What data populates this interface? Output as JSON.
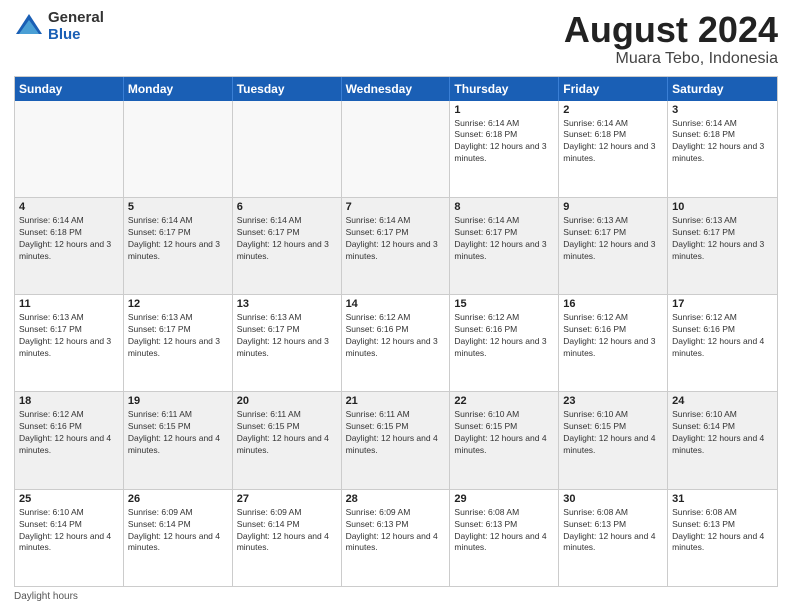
{
  "header": {
    "logo_general": "General",
    "logo_blue": "Blue",
    "title": "August 2024",
    "location": "Muara Tebo, Indonesia"
  },
  "calendar": {
    "days_of_week": [
      "Sunday",
      "Monday",
      "Tuesday",
      "Wednesday",
      "Thursday",
      "Friday",
      "Saturday"
    ],
    "weeks": [
      [
        {
          "day": "",
          "empty": true
        },
        {
          "day": "",
          "empty": true
        },
        {
          "day": "",
          "empty": true
        },
        {
          "day": "",
          "empty": true
        },
        {
          "day": "1",
          "sunrise": "6:14 AM",
          "sunset": "6:18 PM",
          "daylight": "12 hours and 3 minutes."
        },
        {
          "day": "2",
          "sunrise": "6:14 AM",
          "sunset": "6:18 PM",
          "daylight": "12 hours and 3 minutes."
        },
        {
          "day": "3",
          "sunrise": "6:14 AM",
          "sunset": "6:18 PM",
          "daylight": "12 hours and 3 minutes."
        }
      ],
      [
        {
          "day": "4",
          "sunrise": "6:14 AM",
          "sunset": "6:18 PM",
          "daylight": "12 hours and 3 minutes."
        },
        {
          "day": "5",
          "sunrise": "6:14 AM",
          "sunset": "6:17 PM",
          "daylight": "12 hours and 3 minutes."
        },
        {
          "day": "6",
          "sunrise": "6:14 AM",
          "sunset": "6:17 PM",
          "daylight": "12 hours and 3 minutes."
        },
        {
          "day": "7",
          "sunrise": "6:14 AM",
          "sunset": "6:17 PM",
          "daylight": "12 hours and 3 minutes."
        },
        {
          "day": "8",
          "sunrise": "6:14 AM",
          "sunset": "6:17 PM",
          "daylight": "12 hours and 3 minutes."
        },
        {
          "day": "9",
          "sunrise": "6:13 AM",
          "sunset": "6:17 PM",
          "daylight": "12 hours and 3 minutes."
        },
        {
          "day": "10",
          "sunrise": "6:13 AM",
          "sunset": "6:17 PM",
          "daylight": "12 hours and 3 minutes."
        }
      ],
      [
        {
          "day": "11",
          "sunrise": "6:13 AM",
          "sunset": "6:17 PM",
          "daylight": "12 hours and 3 minutes."
        },
        {
          "day": "12",
          "sunrise": "6:13 AM",
          "sunset": "6:17 PM",
          "daylight": "12 hours and 3 minutes."
        },
        {
          "day": "13",
          "sunrise": "6:13 AM",
          "sunset": "6:17 PM",
          "daylight": "12 hours and 3 minutes."
        },
        {
          "day": "14",
          "sunrise": "6:12 AM",
          "sunset": "6:16 PM",
          "daylight": "12 hours and 3 minutes."
        },
        {
          "day": "15",
          "sunrise": "6:12 AM",
          "sunset": "6:16 PM",
          "daylight": "12 hours and 3 minutes."
        },
        {
          "day": "16",
          "sunrise": "6:12 AM",
          "sunset": "6:16 PM",
          "daylight": "12 hours and 3 minutes."
        },
        {
          "day": "17",
          "sunrise": "6:12 AM",
          "sunset": "6:16 PM",
          "daylight": "12 hours and 4 minutes."
        }
      ],
      [
        {
          "day": "18",
          "sunrise": "6:12 AM",
          "sunset": "6:16 PM",
          "daylight": "12 hours and 4 minutes."
        },
        {
          "day": "19",
          "sunrise": "6:11 AM",
          "sunset": "6:15 PM",
          "daylight": "12 hours and 4 minutes."
        },
        {
          "day": "20",
          "sunrise": "6:11 AM",
          "sunset": "6:15 PM",
          "daylight": "12 hours and 4 minutes."
        },
        {
          "day": "21",
          "sunrise": "6:11 AM",
          "sunset": "6:15 PM",
          "daylight": "12 hours and 4 minutes."
        },
        {
          "day": "22",
          "sunrise": "6:10 AM",
          "sunset": "6:15 PM",
          "daylight": "12 hours and 4 minutes."
        },
        {
          "day": "23",
          "sunrise": "6:10 AM",
          "sunset": "6:15 PM",
          "daylight": "12 hours and 4 minutes."
        },
        {
          "day": "24",
          "sunrise": "6:10 AM",
          "sunset": "6:14 PM",
          "daylight": "12 hours and 4 minutes."
        }
      ],
      [
        {
          "day": "25",
          "sunrise": "6:10 AM",
          "sunset": "6:14 PM",
          "daylight": "12 hours and 4 minutes."
        },
        {
          "day": "26",
          "sunrise": "6:09 AM",
          "sunset": "6:14 PM",
          "daylight": "12 hours and 4 minutes."
        },
        {
          "day": "27",
          "sunrise": "6:09 AM",
          "sunset": "6:14 PM",
          "daylight": "12 hours and 4 minutes."
        },
        {
          "day": "28",
          "sunrise": "6:09 AM",
          "sunset": "6:13 PM",
          "daylight": "12 hours and 4 minutes."
        },
        {
          "day": "29",
          "sunrise": "6:08 AM",
          "sunset": "6:13 PM",
          "daylight": "12 hours and 4 minutes."
        },
        {
          "day": "30",
          "sunrise": "6:08 AM",
          "sunset": "6:13 PM",
          "daylight": "12 hours and 4 minutes."
        },
        {
          "day": "31",
          "sunrise": "6:08 AM",
          "sunset": "6:13 PM",
          "daylight": "12 hours and 4 minutes."
        }
      ]
    ]
  },
  "footer": {
    "daylight_label": "Daylight hours"
  },
  "labels": {
    "sunrise": "Sunrise:",
    "sunset": "Sunset:",
    "daylight": "Daylight:"
  }
}
